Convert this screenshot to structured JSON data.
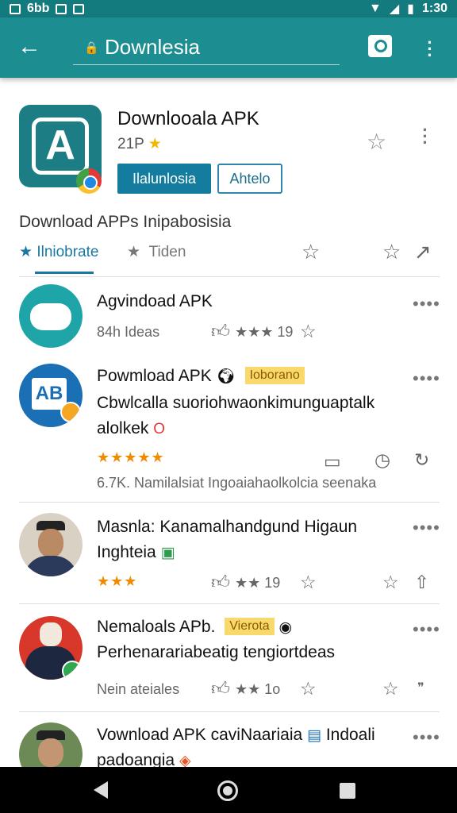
{
  "status_bar": {
    "left_text": "6bb",
    "time": "1:30"
  },
  "app_bar": {
    "search_text": "Downlesia"
  },
  "hero": {
    "app_name": "Downlooala APK",
    "size_text": "21P",
    "primary_button": "Ilalunlosia",
    "secondary_button": "Ahtelo",
    "section_title": "Download APPs Inipabosisia",
    "tab_active": "Ilniobrate",
    "tab_inactive": "Tiden"
  },
  "items": [
    {
      "title": "Agvindoad APK",
      "meta": "84h Ideas",
      "count": "19"
    },
    {
      "title": "Powmload APK",
      "tag": "Ioborano",
      "line1": "Cbwlcalla suoriohwaonkimunguaptalk",
      "line2": "alolkek",
      "meta": "6.7K. Namilalsiat Ingoaiahaolkolcia seenaka"
    },
    {
      "title": "Masnla: Kanamalhandgund Higaun",
      "line1": "Inghteia",
      "count": "19"
    },
    {
      "title": "Nemaloals APb.",
      "tag": "Vierota",
      "line1": "Perhenarariabeatig tengiortdeas",
      "meta": "Nein ateiales",
      "count": "1o"
    },
    {
      "title": "Vownload APK caviNaariaia",
      "title_suffix": "Indoali",
      "line1": "padoangia"
    }
  ],
  "colors": {
    "app_bar": "#1c8e92",
    "status_bar": "#137a7e",
    "primary_button": "#147c9f",
    "tag": "#f9d96b",
    "stars": "#f08a00"
  },
  "icons": [
    "back-arrow-icon",
    "lock-icon",
    "search-icon",
    "more-vert-icon",
    "star-outline-icon",
    "share-icon",
    "thumbs-up-icon",
    "comment-icon",
    "clock-icon",
    "more-horiz-icon"
  ]
}
